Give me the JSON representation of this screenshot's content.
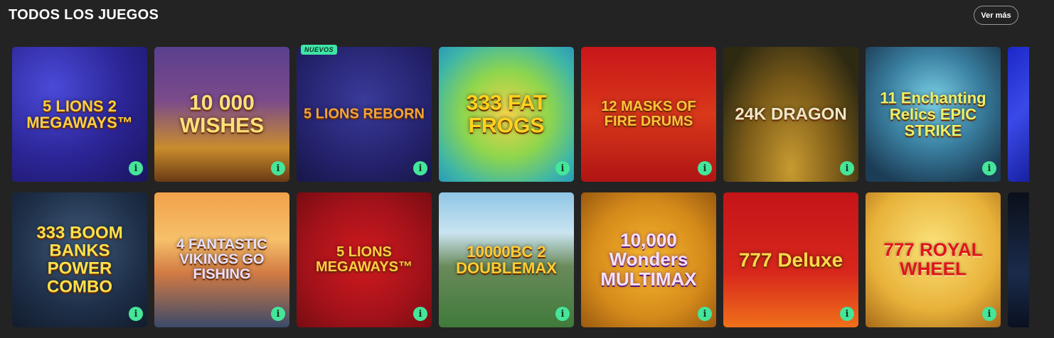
{
  "section": {
    "title": "TODOS LOS JUEGOS",
    "see_more_label": "Ver más"
  },
  "info_glyph": "i",
  "new_badge": "NUEVOS",
  "accent_color": "#45e59a",
  "rows": [
    [
      {
        "logo": "5 LIONS 2 MEGAWAYS™",
        "badge": false
      },
      {
        "logo": "10 000 WISHES",
        "badge": false
      },
      {
        "logo": "5 LIONS REBORN",
        "badge": true
      },
      {
        "logo": "333 FAT FROGS",
        "badge": false
      },
      {
        "logo": "12 MASKS OF FIRE DRUMS",
        "badge": false
      },
      {
        "logo": "24K DRAGON",
        "badge": false
      },
      {
        "logo": "11 Enchanting Relics EPIC STRIKE",
        "badge": false
      }
    ],
    [
      {
        "logo": "333 BOOM BANKS POWER COMBO",
        "badge": false
      },
      {
        "logo": "4 FANTASTIC VIKINGS GO FISHING",
        "badge": false
      },
      {
        "logo": "5 LIONS MEGAWAYS™",
        "badge": false
      },
      {
        "logo": "10000BC 2 DOUBLEMAX",
        "badge": false
      },
      {
        "logo": "10,000 Wonders MULTIMAX",
        "badge": false
      },
      {
        "logo": "777 Deluxe",
        "badge": false
      },
      {
        "logo": "777 ROYAL WHEEL",
        "badge": false
      }
    ]
  ]
}
